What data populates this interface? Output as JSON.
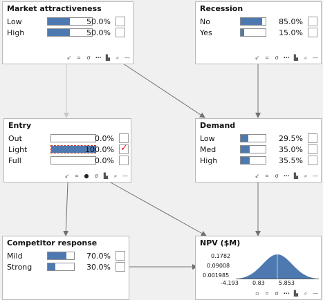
{
  "nodes": {
    "market": {
      "title": "Market attractiveness",
      "states": [
        {
          "label": "Low",
          "value": 0.5,
          "pct": "50.0%",
          "checked": false
        },
        {
          "label": "High",
          "value": 0.5,
          "pct": "50.0%",
          "checked": false
        }
      ]
    },
    "recession": {
      "title": "Recession",
      "states": [
        {
          "label": "No",
          "value": 0.85,
          "pct": "85.0%",
          "checked": false
        },
        {
          "label": "Yes",
          "value": 0.15,
          "pct": "15.0%",
          "checked": false
        }
      ]
    },
    "entry": {
      "title": "Entry",
      "states": [
        {
          "label": "Out",
          "value": 0.0,
          "pct": "0.0%",
          "checked": false
        },
        {
          "label": "Light",
          "value": 1.0,
          "pct": "100.0%",
          "checked": true
        },
        {
          "label": "Full",
          "value": 0.0,
          "pct": "0.0%",
          "checked": false
        }
      ]
    },
    "demand": {
      "title": "Demand",
      "states": [
        {
          "label": "Low",
          "value": 0.295,
          "pct": "29.5%",
          "checked": false
        },
        {
          "label": "Med",
          "value": 0.35,
          "pct": "35.0%",
          "checked": false
        },
        {
          "label": "High",
          "value": 0.355,
          "pct": "35.5%",
          "checked": false
        }
      ]
    },
    "competitor": {
      "title": "Competitor response",
      "states": [
        {
          "label": "Mild",
          "value": 0.7,
          "pct": "70.0%",
          "checked": false
        },
        {
          "label": "Strong",
          "value": 0.3,
          "pct": "30.0%",
          "checked": false
        }
      ]
    },
    "npv": {
      "title": "NPV ($M)",
      "y_ticks": [
        "0.1782",
        "0.09008",
        "0.001985"
      ],
      "x_ticks": [
        "-4.193",
        "0.83",
        "5.853"
      ]
    }
  },
  "chart_data": {
    "type": "area",
    "title": "NPV ($M)",
    "x_ticks": [
      -4.193,
      0.83,
      5.853
    ],
    "y_ticks": [
      0.1782,
      0.09008,
      0.001985
    ],
    "mean": 0.83,
    "sd": 2.2,
    "ylim": [
      0.001985,
      0.1782
    ],
    "color": "#4d79b0"
  },
  "colors": {
    "bar_fill": "#4d79b0",
    "evidence_border": "#c0392b",
    "check_mark": "#d11",
    "wire": "#707070",
    "wire_light": "#c8c8c8"
  },
  "toolbar_icons": [
    "arrow-icon",
    "grid-icon",
    "sigma-icon",
    "dots-icon",
    "histogram-icon",
    "zoom-icon",
    "minus-icon"
  ],
  "check_glyph": "✓"
}
